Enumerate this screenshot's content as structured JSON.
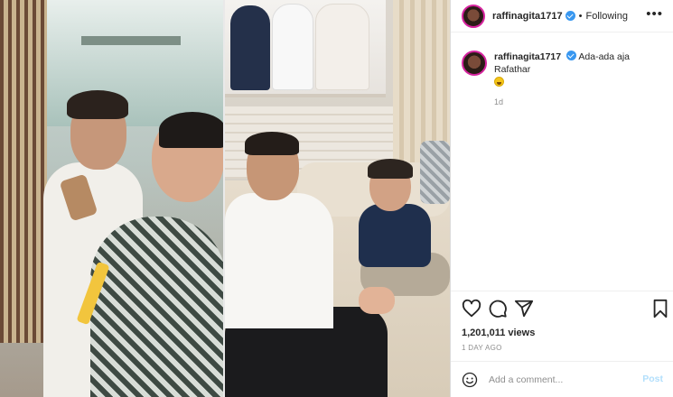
{
  "post": {
    "username": "raffinagita1717",
    "separator": "•",
    "follow_status": "Following",
    "more_label": "•••",
    "caption_text": "Ada-ada aja Rafathar",
    "caption_emoji": "grinning-face-emoji",
    "relative_time": "1d",
    "views": "1,201,011 views",
    "timestamp": "1 DAY AGO"
  },
  "actions": {
    "icons": [
      "heart-icon",
      "comment-icon",
      "share-icon",
      "bookmark-icon"
    ]
  },
  "comment_box": {
    "placeholder": "Add a comment...",
    "post_label": "Post"
  },
  "colors": {
    "verified": "#3897f0",
    "story_ring": "#d6249f",
    "post_disabled": "#b2dffc",
    "muted_text": "#8e8e8e"
  }
}
